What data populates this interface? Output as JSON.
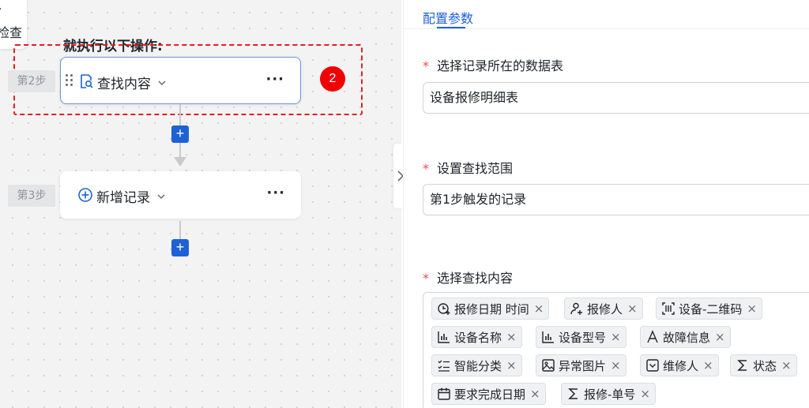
{
  "canvas": {
    "step1_partial_text": "检查",
    "ops_title": "就执行以下操作:",
    "steps": [
      {
        "label": "第2步",
        "title": "查找内容"
      },
      {
        "label": "第3步",
        "title": "新增记录"
      }
    ],
    "more_label": "···",
    "badge": "2",
    "add_label": "+"
  },
  "panel": {
    "tab_label": "配置参数",
    "fields": [
      {
        "label": "选择记录所在的数据表",
        "value": "设备报修明细表"
      },
      {
        "label": "设置查找范围",
        "value": "第1步触发的记录"
      },
      {
        "label": "选择查找内容"
      }
    ],
    "required_mark": "*",
    "tags": [
      {
        "label": "报修日期 时间",
        "icon": "clock-plus-icon"
      },
      {
        "label": "报修人",
        "icon": "person-plus-icon"
      },
      {
        "label": "设备-二维码",
        "icon": "qrcode-icon"
      },
      {
        "label": "设备名称",
        "icon": "bar-chart-icon"
      },
      {
        "label": "设备型号",
        "icon": "bar-chart-icon"
      },
      {
        "label": "故障信息",
        "icon": "text-a-icon"
      },
      {
        "label": "智能分类",
        "icon": "checklist-icon"
      },
      {
        "label": "异常图片",
        "icon": "image-icon"
      },
      {
        "label": "维修人",
        "icon": "dropdown-box-icon"
      },
      {
        "label": "状态",
        "icon": "sigma-icon"
      },
      {
        "label": "要求完成日期",
        "icon": "calendar-icon"
      },
      {
        "label": "报修-单号",
        "icon": "sigma-icon"
      }
    ],
    "tag_close": "×"
  },
  "colors": {
    "accent": "#1e61d6",
    "badge": "#f00000",
    "dashed": "#e02020",
    "required": "#f54a45"
  }
}
